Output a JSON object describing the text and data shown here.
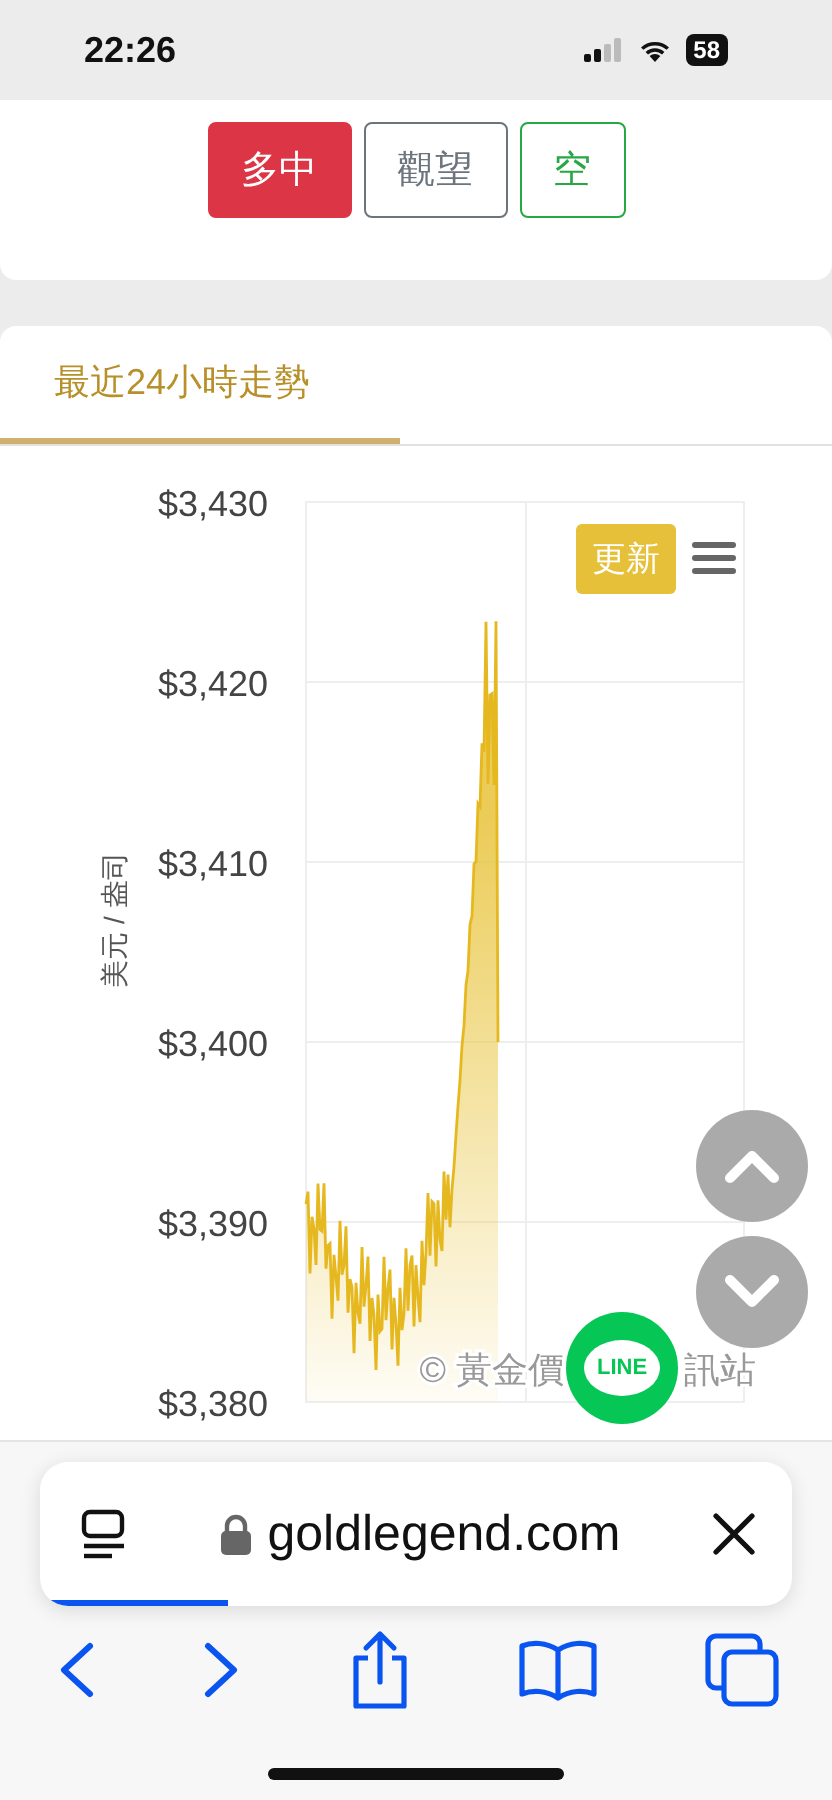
{
  "status_bar": {
    "time": "22:26",
    "battery": "58"
  },
  "signal_buttons": [
    {
      "label": "多中",
      "kind": "long",
      "selected": true
    },
    {
      "label": "觀望",
      "kind": "neutral",
      "selected": false
    },
    {
      "label": "空",
      "kind": "short",
      "selected": false
    }
  ],
  "tabs": [
    {
      "label": "最近24小時走勢",
      "selected": true
    }
  ],
  "chart": {
    "ylabel": "美元 / 盎司",
    "yticks": [
      "$3,430",
      "$3,420",
      "$3,410",
      "$3,400",
      "$3,390",
      "$3,380"
    ],
    "refresh_button": "更新",
    "watermark": [
      "© 黃金價",
      "訊站"
    ]
  },
  "floating": {
    "line_label": "LINE"
  },
  "browser": {
    "url": "goldlegend.com",
    "level": 0.25
  }
}
